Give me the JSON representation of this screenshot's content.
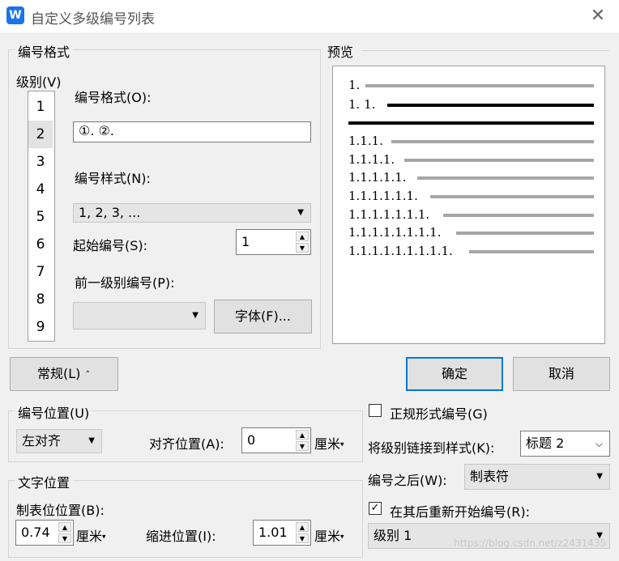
{
  "window": {
    "title": "自定义多级编号列表",
    "icon": "wps-logo",
    "close": "✕"
  },
  "format_group": {
    "legend": "编号格式",
    "level_label": "级别(V)",
    "levels": [
      "1",
      "2",
      "3",
      "4",
      "5",
      "6",
      "7",
      "8",
      "9"
    ],
    "selected_level": "2",
    "number_format_label": "编号格式(O):",
    "number_format_value": "①. ②.",
    "number_style_label": "编号样式(N):",
    "number_style_value": "1, 2, 3, ...",
    "start_at_label": "起始编号(S):",
    "start_at_value": "1",
    "prev_level_label": "前一级别编号(P):",
    "prev_level_value": "",
    "font_button": "字体(F)..."
  },
  "preview": {
    "legend": "预览",
    "lines": [
      "1.",
      "1. 1.",
      "",
      "1.1.1.",
      "1.1.1.1.",
      "1.1.1.1.1.",
      "1.1.1.1.1.1.",
      "1.1.1.1.1.1.1.",
      "1.1.1.1.1.1.1.1.",
      "1.1.1.1.1.1.1.1.1."
    ]
  },
  "buttons": {
    "general": "常规(L)",
    "general_icon": "⌃",
    "ok": "确定",
    "cancel": "取消"
  },
  "position_group": {
    "legend": "编号位置(U)",
    "align_value": "左对齐",
    "align_at_label": "对齐位置(A):",
    "align_at_value": "0",
    "unit": "厘米"
  },
  "text_group": {
    "legend": "文字位置",
    "tab_label": "制表位位置(B):",
    "tab_value": "0.74",
    "indent_label": "缩进位置(I):",
    "indent_value": "1.01",
    "unit": "厘米"
  },
  "right_options": {
    "legal_label": "正规形式编号(G)",
    "legal_checked": false,
    "link_label": "将级别链接到样式(K):",
    "link_value": "标题 2",
    "follow_label": "编号之后(W):",
    "follow_value": "制表符",
    "restart_label": "在其后重新开始编号(R):",
    "restart_checked": true,
    "restart_value": "级别 1"
  },
  "watermark": "https://blog.csdn.net/z2431435"
}
